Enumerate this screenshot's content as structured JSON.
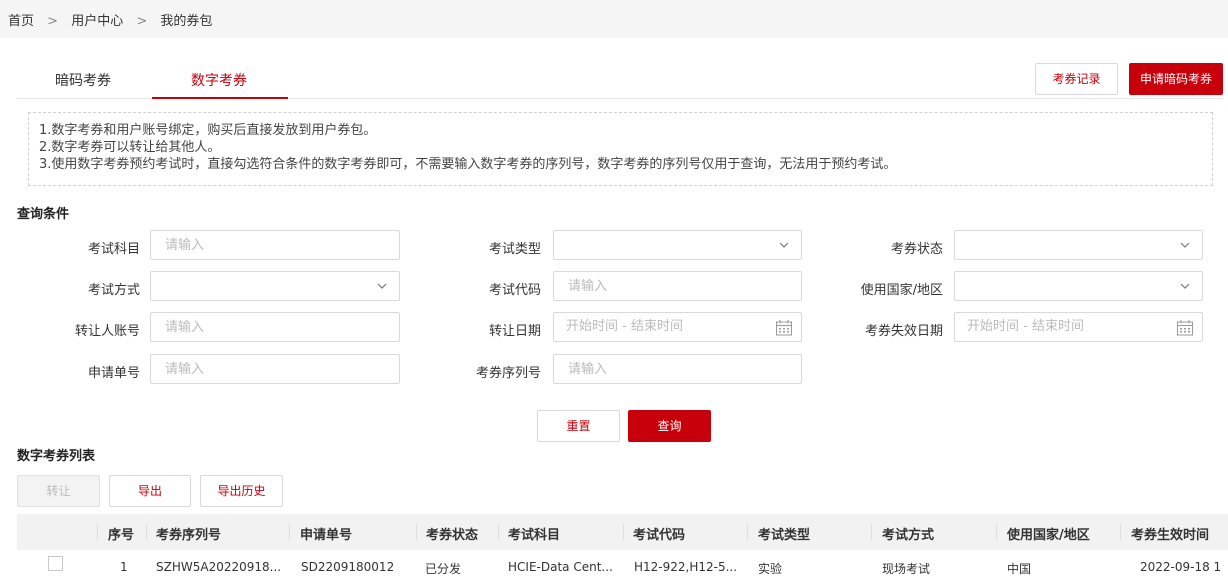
{
  "breadcrumb": {
    "items": [
      "首页",
      "用户中心",
      "我的券包"
    ],
    "separator": ">"
  },
  "tabs": {
    "items": [
      "暗码考券",
      "数字考券"
    ],
    "active_index": 1
  },
  "header_actions": {
    "record_label": "考券记录",
    "apply_label": "申请暗码考券"
  },
  "notice": {
    "lines": [
      "1.数字考券和用户账号绑定，购买后直接发放到用户券包。",
      "2.数字考券可以转让给其他人。",
      "3.使用数字考券预约考试时，直接勾选符合条件的数字考券即可，不需要输入数字考券的序列号，数字考券的序列号仅用于查询，无法用于预约考试。"
    ]
  },
  "query": {
    "title": "查询条件",
    "fields": {
      "subject": {
        "label": "考试科目",
        "placeholder": "请输入"
      },
      "exam_type": {
        "label": "考试类型",
        "value": ""
      },
      "voucher_status": {
        "label": "考券状态",
        "value": ""
      },
      "exam_method": {
        "label": "考试方式",
        "value": ""
      },
      "exam_code": {
        "label": "考试代码",
        "placeholder": "请输入"
      },
      "country": {
        "label": "使用国家/地区",
        "value": ""
      },
      "transferee": {
        "label": "转让人账号",
        "placeholder": "请输入"
      },
      "transfer_date": {
        "label": "转让日期",
        "placeholder": "开始时间 - 结束时间"
      },
      "expiry_date": {
        "label": "考券失效日期",
        "placeholder": "开始时间 - 结束时间"
      },
      "apply_no": {
        "label": "申请单号",
        "placeholder": "请输入"
      },
      "serial_no": {
        "label": "考券序列号",
        "placeholder": "请输入"
      }
    },
    "reset_label": "重置",
    "search_label": "查询"
  },
  "list": {
    "title": "数字考券列表",
    "transfer_label": "转让",
    "export_label": "导出",
    "export_history_label": "导出历史",
    "columns": [
      "序号",
      "考券序列号",
      "申请单号",
      "考券状态",
      "考试科目",
      "考试代码",
      "考试类型",
      "考试方式",
      "使用国家/地区",
      "考券生效时间"
    ],
    "rows": [
      {
        "index": "1",
        "serial": "SZHW5A20220918...",
        "apply_no": "SD2209180012",
        "status": "已分发",
        "subject": "HCIE-Data Cent...",
        "code": "H12-922,H12-5...",
        "type": "实验",
        "method": "现场考试",
        "country": "中国",
        "effective": "2022-09-18 1"
      }
    ]
  },
  "colors": {
    "accent": "#c7000b",
    "topbar": "#f5f5f5",
    "table_header": "#f2f2f2"
  }
}
